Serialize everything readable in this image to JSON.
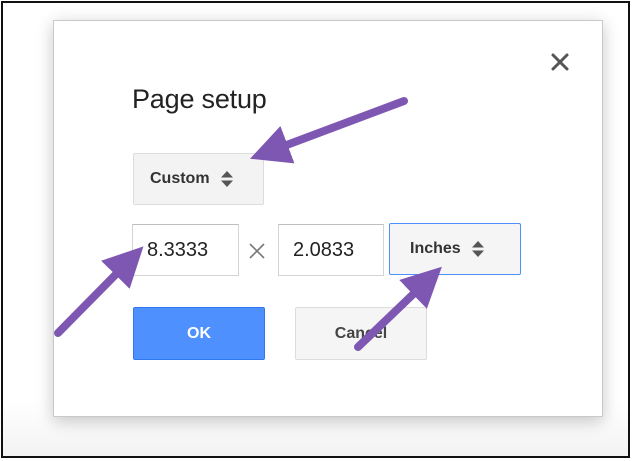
{
  "dialog": {
    "title": "Page setup",
    "close_icon": "close-icon",
    "page_size": {
      "selected": "Custom",
      "icon": "up-down-icon"
    },
    "width_value": "8.3333",
    "times_icon": "times-icon",
    "height_value": "2.0833",
    "units": {
      "selected": "Inches",
      "icon": "up-down-icon"
    },
    "ok_label": "OK",
    "cancel_label": "Cancel"
  },
  "annotations": {
    "arrow_color": "#7e57b2",
    "arrow_icon": "annotation-arrow",
    "count": 4
  },
  "colors": {
    "primary_button": "#4d90fe",
    "focus_border": "#4d90fe",
    "neutral_button": "#f5f5f5"
  }
}
